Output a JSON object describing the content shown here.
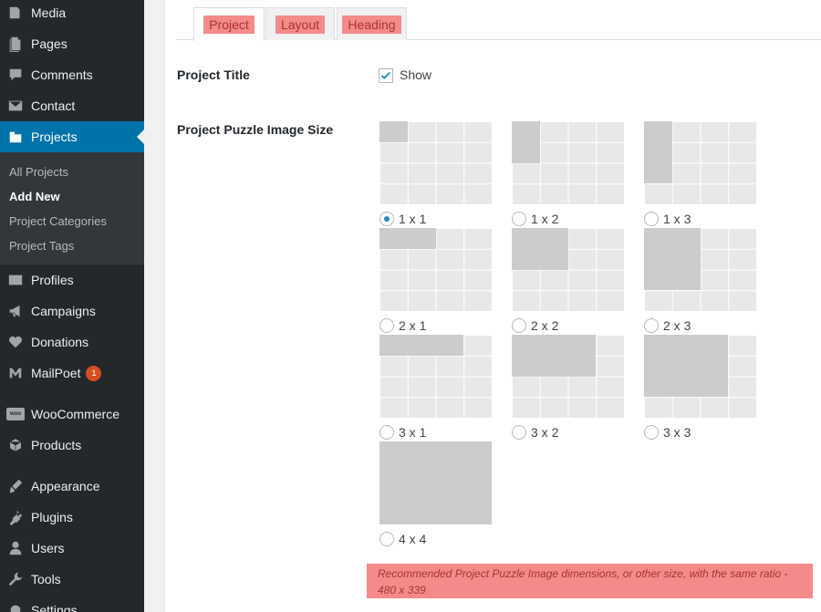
{
  "sidebar": {
    "items": [
      {
        "label": "Media",
        "icon": "media-icon"
      },
      {
        "label": "Pages",
        "icon": "pages-icon"
      },
      {
        "label": "Comments",
        "icon": "comments-icon"
      },
      {
        "label": "Contact",
        "icon": "mail-icon"
      },
      {
        "label": "Projects",
        "icon": "portfolio-icon"
      },
      {
        "label": "Profiles",
        "icon": "id-card-icon"
      },
      {
        "label": "Campaigns",
        "icon": "megaphone-icon"
      },
      {
        "label": "Donations",
        "icon": "heart-icon"
      },
      {
        "label": "MailPoet",
        "icon": "mailpoet-icon",
        "badge": "1"
      },
      {
        "label": "WooCommerce",
        "icon": "woocommerce-icon"
      },
      {
        "label": "Products",
        "icon": "box-icon"
      },
      {
        "label": "Appearance",
        "icon": "brush-icon"
      },
      {
        "label": "Plugins",
        "icon": "plug-icon"
      },
      {
        "label": "Users",
        "icon": "user-icon"
      },
      {
        "label": "Tools",
        "icon": "wrench-icon"
      },
      {
        "label": "Settings",
        "icon": "settings-icon"
      }
    ],
    "submenu": [
      "All Projects",
      "Add New",
      "Project Categories",
      "Project Tags"
    ],
    "woo_icon_text": "woo"
  },
  "tabs": [
    "Project",
    "Layout",
    "Heading"
  ],
  "fields": {
    "project_title_label": "Project Title",
    "show_label": "Show",
    "show_checked": true,
    "puzzle_size_label": "Project Puzzle Image Size"
  },
  "sizes": [
    {
      "label": "1 x 1",
      "cols": 1,
      "rows": 1,
      "selected": true
    },
    {
      "label": "1 x 2",
      "cols": 1,
      "rows": 2,
      "selected": false
    },
    {
      "label": "1 x 3",
      "cols": 1,
      "rows": 3,
      "selected": false
    },
    {
      "label": "2 x 1",
      "cols": 2,
      "rows": 1,
      "selected": false
    },
    {
      "label": "2 x 2",
      "cols": 2,
      "rows": 2,
      "selected": false
    },
    {
      "label": "2 x 3",
      "cols": 2,
      "rows": 3,
      "selected": false
    },
    {
      "label": "3 x 1",
      "cols": 3,
      "rows": 1,
      "selected": false
    },
    {
      "label": "3 x 2",
      "cols": 3,
      "rows": 2,
      "selected": false
    },
    {
      "label": "3 x 3",
      "cols": 3,
      "rows": 3,
      "selected": false
    },
    {
      "label": "4 x 4",
      "cols": 4,
      "rows": 4,
      "selected": false
    }
  ],
  "note": "Recommended Project Puzzle Image dimensions, or other size, with the same ratio - 480 x 339",
  "colors": {
    "sidebar_bg": "#23282d",
    "active_menu": "#0073aa",
    "highlight": "#f48a8a",
    "puzzle_fill": "#cccccc"
  }
}
